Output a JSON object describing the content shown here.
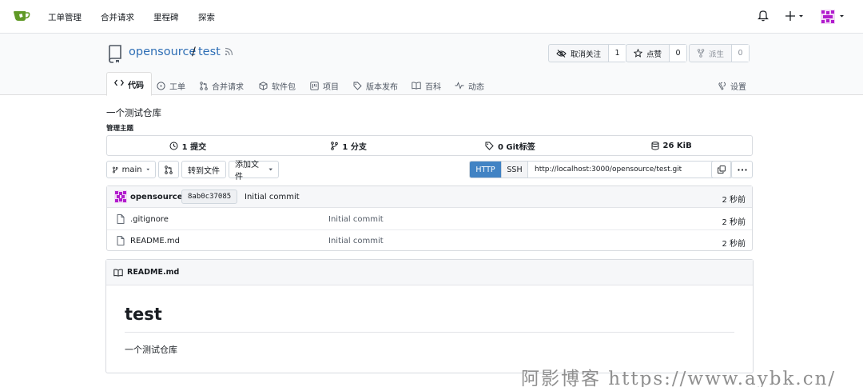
{
  "nav": {
    "links": [
      "工单管理",
      "合并请求",
      "里程碑",
      "探索"
    ],
    "accent": "#609926"
  },
  "repo": {
    "owner": "opensource",
    "separator": "/",
    "name": "test",
    "unwatch": {
      "label": "取消关注",
      "count": "1"
    },
    "star": {
      "label": "点赞",
      "count": "0"
    },
    "fork": {
      "label": "派生",
      "count": "0"
    }
  },
  "tabs": {
    "code": "代码",
    "issues": "工单",
    "pulls": "合并请求",
    "packages": "软件包",
    "projects": "项目",
    "releases": "版本发布",
    "wiki": "百科",
    "activity": "动态",
    "settings": "设置"
  },
  "description": "一个测试仓库",
  "topics_label": "管理主题",
  "stats": {
    "commits": "1 提交",
    "branches": "1 分支",
    "tags": "0 Git标签",
    "size": "26 KiB"
  },
  "toolbar": {
    "branch": "main",
    "goto_file": "转到文件",
    "add_file": "添加文件",
    "http": "HTTP",
    "ssh": "SSH",
    "clone_url": "http://localhost:3000/opensource/test.git"
  },
  "latest_commit": {
    "author": "opensource",
    "sha": "8ab0c37085",
    "message": "Initial commit",
    "time": "2 秒前"
  },
  "files": [
    {
      "name": ".gitignore",
      "commit": "Initial commit",
      "time": "2 秒前"
    },
    {
      "name": "README.md",
      "commit": "Initial commit",
      "time": "2 秒前"
    }
  ],
  "readme": {
    "filename": "README.md",
    "heading": "test",
    "text": "一个测试仓库"
  },
  "watermark": "阿影博客 https://www.aybk.cn/"
}
